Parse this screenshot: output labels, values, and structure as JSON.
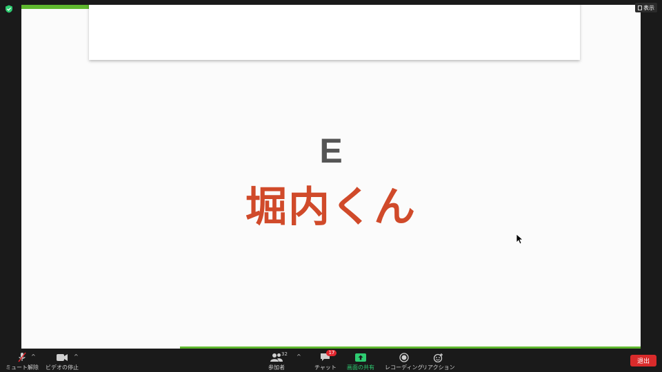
{
  "slide": {
    "letter": "E",
    "name": "堀内くん"
  },
  "top_controls": {
    "view_label": "表示",
    "security_icon": "shield-check-icon"
  },
  "toolbar": {
    "mute_label": "ミュート解除",
    "video_label": "ビデオの停止",
    "participants_label": "参加者",
    "participants_count": "32",
    "chat_label": "チャット",
    "chat_badge": "17",
    "share_label": "画面の共有",
    "record_label": "レコーディング",
    "reactions_label": "リアクション",
    "leave_label": "退出"
  },
  "colors": {
    "accent_green": "#2ecc71",
    "slide_name_red": "#d04a2a",
    "leave_red": "#d92b2b"
  }
}
